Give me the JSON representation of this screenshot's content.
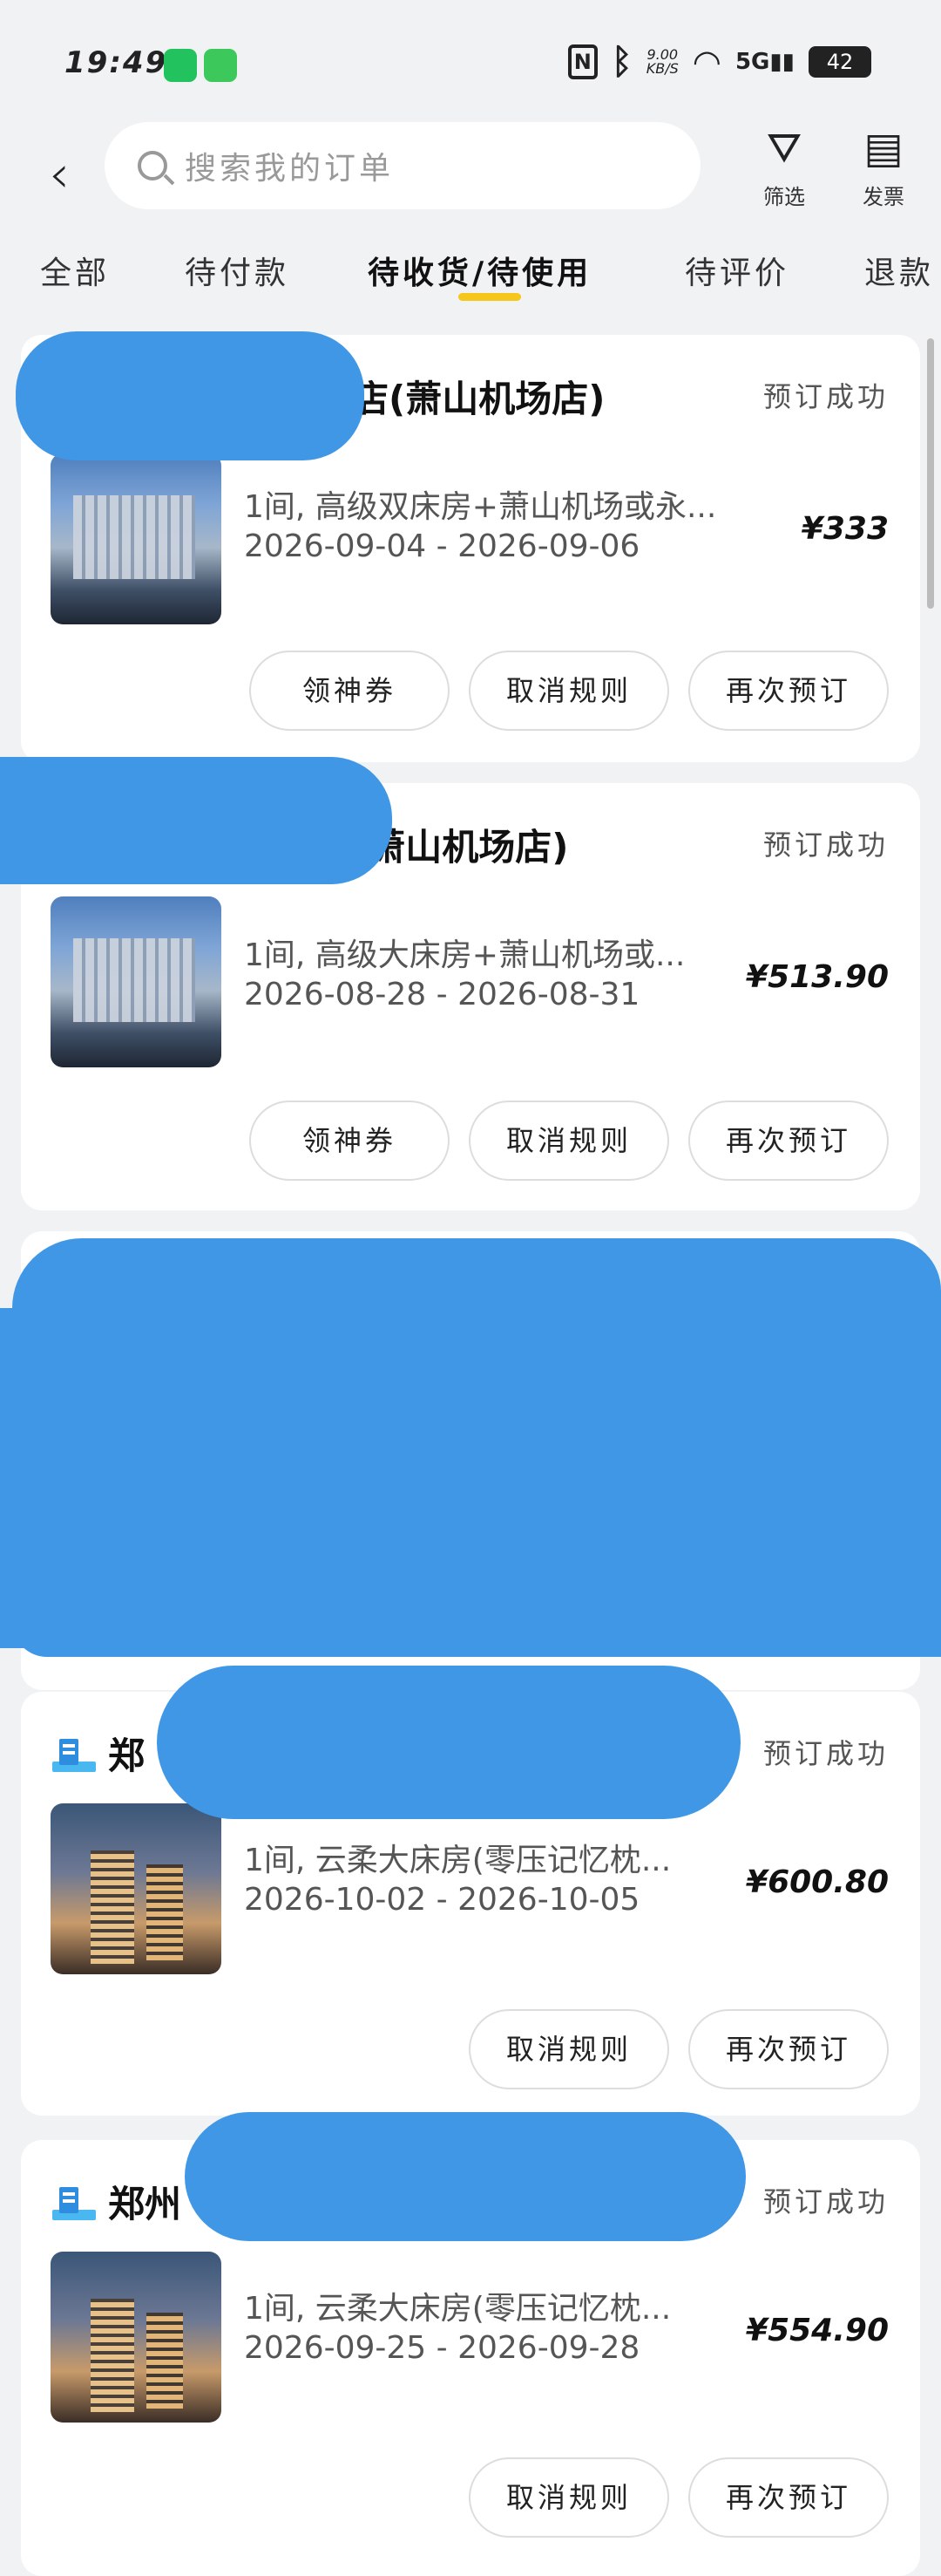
{
  "status_bar": {
    "time": "19:49",
    "speed": "9.00",
    "speed_unit": "KB/S",
    "network": "5G",
    "battery": "42"
  },
  "header": {
    "search_placeholder": "搜索我的订单",
    "filter_label": "筛选",
    "invoice_label": "发票"
  },
  "tabs": [
    "全部",
    "待付款",
    "待收货/待使用",
    "待评价",
    "退款"
  ],
  "orders": [
    {
      "hotel_name": "店(萧山机场店)",
      "status": "预订成功",
      "room": "1间, 高级双床房+萧山机场或永...",
      "dates": "2026-09-04 - 2026-09-06",
      "price": "¥333",
      "buttons": [
        "领神券",
        "取消规则",
        "再次预订"
      ]
    },
    {
      "hotel_name": "(萧山机场店)",
      "status": "预订成功",
      "room": "1间, 高级大床房+萧山机场或...",
      "dates": "2026-08-28 - 2026-08-31",
      "price": "¥513.90",
      "buttons": [
        "领神券",
        "取消规则",
        "再次预订"
      ]
    },
    {
      "hotel_name": "郑",
      "status": "预订成功",
      "room": "1间, 云柔大床房(零压记忆枕...",
      "dates": "2026-10-02 - 2026-10-05",
      "price": "¥600.80",
      "buttons": [
        "取消规则",
        "再次预订"
      ]
    },
    {
      "hotel_name": "郑州",
      "status": "预订成功",
      "room": "1间, 云柔大床房(零压记忆枕...",
      "dates": "2026-09-25 - 2026-09-28",
      "price": "¥554.90",
      "buttons": [
        "取消规则",
        "再次预订"
      ]
    }
  ]
}
